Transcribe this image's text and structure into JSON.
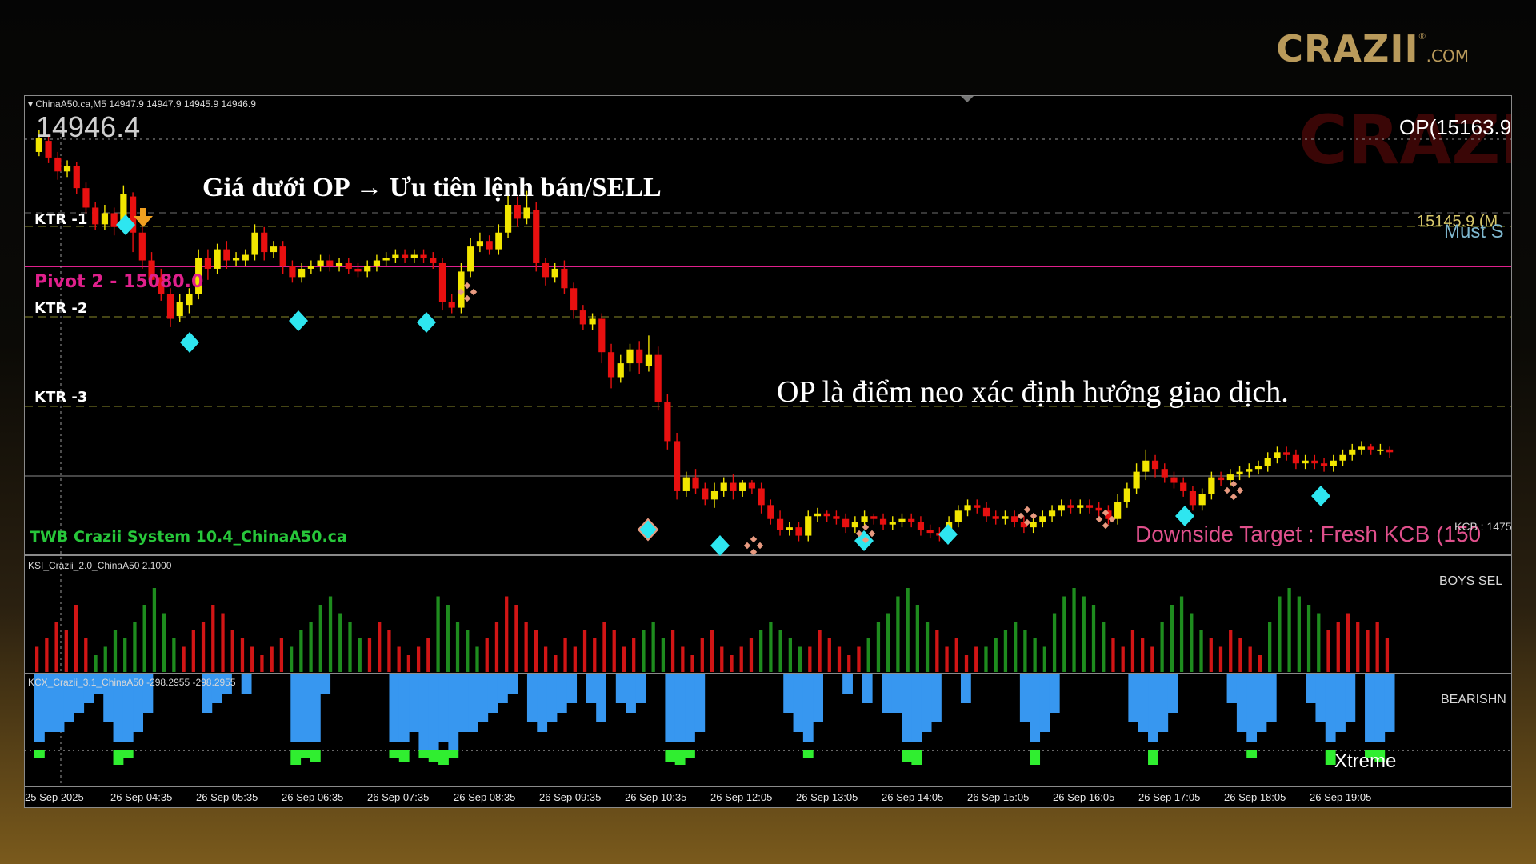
{
  "brand": {
    "name": "CRAZII",
    "reg": "®",
    "suffix": ".COM"
  },
  "chart": {
    "header": "ChinaA50.ca,M5  14947.9 14947.9 14945.9 14946.9",
    "current_price": "14946.4",
    "op_label": "OP(15163.9",
    "watermark": "CRAZII",
    "level_151": "15145.9 (M",
    "must_label": "Must S",
    "annotation_top": "Giá dưới OP → Ưu tiên lệnh bán/SELL",
    "annotation_mid": "OP là điểm neo xác định hướng giao dịch.",
    "ktr1": "KTR -1",
    "pivot2": "Pivot 2 - 15080.0",
    "ktr2": "KTR -2",
    "ktr3": "KTR -3",
    "system_label": "TWB Crazii System 10.4_ChinaA50.ca",
    "downside_target": "Downside Target : Fresh KCB (150",
    "kcb_label": "KCB : 1475"
  },
  "ksi": {
    "label": "KSI_Crazii_2.0_ChinaA50 2.1000",
    "side_label": "BOYS SEL"
  },
  "kcx": {
    "label": "KCX_Crazii_3.1_ChinaA50 -298.2955 -298.2955",
    "side_label": "BEARISHN",
    "xtreme": "Xtreme"
  },
  "time_axis": [
    "25 Sep 2025",
    "26 Sep 04:35",
    "26 Sep 05:35",
    "26 Sep 06:35",
    "26 Sep 07:35",
    "26 Sep 08:35",
    "26 Sep 09:35",
    "26 Sep 10:35",
    "26 Sep 12:05",
    "26 Sep 13:05",
    "26 Sep 14:05",
    "26 Sep 15:05",
    "26 Sep 16:05",
    "26 Sep 17:05",
    "26 Sep 18:05",
    "26 Sep 19:05"
  ],
  "colors": {
    "bull": "#f2e600",
    "bear": "#e81010",
    "pivot": "#e0208c",
    "diamond": "#2ee6f0",
    "system": "#27c73a",
    "target": "#e0508c",
    "hist_green": "#1e8c1e",
    "hist_red": "#d11515",
    "kcx_blue": "#3797f0",
    "kcx_green": "#30ee30"
  },
  "price_series": [
    {
      "o": 15142,
      "c": 15152,
      "h": 15158,
      "l": 15139
    },
    {
      "o": 15150,
      "c": 15138,
      "h": 15155,
      "l": 15134
    },
    {
      "o": 15138,
      "c": 15128,
      "h": 15142,
      "l": 15122
    },
    {
      "o": 15128,
      "c": 15132,
      "h": 15136,
      "l": 15124
    },
    {
      "o": 15132,
      "c": 15116,
      "h": 15135,
      "l": 15112
    },
    {
      "o": 15116,
      "c": 15102,
      "h": 15120,
      "l": 15098
    },
    {
      "o": 15102,
      "c": 15090,
      "h": 15106,
      "l": 15086
    },
    {
      "o": 15090,
      "c": 15098,
      "h": 15104,
      "l": 15086
    },
    {
      "o": 15098,
      "c": 15088,
      "h": 15102,
      "l": 15082
    },
    {
      "o": 15090,
      "c": 15112,
      "h": 15118,
      "l": 15087
    },
    {
      "o": 15110,
      "c": 15084,
      "h": 15113,
      "l": 15070
    },
    {
      "o": 15084,
      "c": 15064,
      "h": 15088,
      "l": 15058
    },
    {
      "o": 15064,
      "c": 15050,
      "h": 15070,
      "l": 15045
    },
    {
      "o": 15052,
      "c": 15040,
      "h": 15058,
      "l": 15035
    },
    {
      "o": 15040,
      "c": 15022,
      "h": 15044,
      "l": 15016
    },
    {
      "o": 15024,
      "c": 15034,
      "h": 15040,
      "l": 15020
    },
    {
      "o": 15032,
      "c": 15040,
      "h": 15044,
      "l": 15026
    },
    {
      "o": 15040,
      "c": 15066,
      "h": 15072,
      "l": 15036
    },
    {
      "o": 15066,
      "c": 15058,
      "h": 15072,
      "l": 15050
    },
    {
      "o": 15058,
      "c": 15072,
      "h": 15076,
      "l": 15054
    },
    {
      "o": 15072,
      "c": 15064,
      "h": 15078,
      "l": 15058
    },
    {
      "o": 15064,
      "c": 15066,
      "h": 15070,
      "l": 15060
    },
    {
      "o": 15064,
      "c": 15068,
      "h": 15072,
      "l": 15060
    },
    {
      "o": 15068,
      "c": 15084,
      "h": 15090,
      "l": 15064
    },
    {
      "o": 15084,
      "c": 15070,
      "h": 15088,
      "l": 15064
    },
    {
      "o": 15070,
      "c": 15074,
      "h": 15078,
      "l": 15066
    },
    {
      "o": 15074,
      "c": 15060,
      "h": 15078,
      "l": 15054
    },
    {
      "o": 15060,
      "c": 15052,
      "h": 15064,
      "l": 15048
    },
    {
      "o": 15052,
      "c": 15058,
      "h": 15062,
      "l": 15048
    },
    {
      "o": 15058,
      "c": 15060,
      "h": 15064,
      "l": 15054
    },
    {
      "o": 15060,
      "c": 15064,
      "h": 15068,
      "l": 15056
    },
    {
      "o": 15064,
      "c": 15060,
      "h": 15068,
      "l": 15056
    },
    {
      "o": 15060,
      "c": 15062,
      "h": 15066,
      "l": 15056
    },
    {
      "o": 15062,
      "c": 15058,
      "h": 15066,
      "l": 15054
    },
    {
      "o": 15058,
      "c": 15056,
      "h": 15062,
      "l": 15052
    },
    {
      "o": 15056,
      "c": 15060,
      "h": 15064,
      "l": 15052
    },
    {
      "o": 15060,
      "c": 15064,
      "h": 15068,
      "l": 15056
    },
    {
      "o": 15064,
      "c": 15066,
      "h": 15070,
      "l": 15060
    },
    {
      "o": 15066,
      "c": 15068,
      "h": 15072,
      "l": 15062
    },
    {
      "o": 15068,
      "c": 15066,
      "h": 15072,
      "l": 15062
    },
    {
      "o": 15066,
      "c": 15068,
      "h": 15072,
      "l": 15062
    },
    {
      "o": 15068,
      "c": 15066,
      "h": 15072,
      "l": 15062
    },
    {
      "o": 15066,
      "c": 15062,
      "h": 15070,
      "l": 15058
    },
    {
      "o": 15062,
      "c": 15034,
      "h": 15066,
      "l": 15028
    },
    {
      "o": 15034,
      "c": 15030,
      "h": 15040,
      "l": 15026
    },
    {
      "o": 15030,
      "c": 15056,
      "h": 15062,
      "l": 15026
    },
    {
      "o": 15056,
      "c": 15074,
      "h": 15080,
      "l": 15052
    },
    {
      "o": 15074,
      "c": 15078,
      "h": 15084,
      "l": 15070
    },
    {
      "o": 15078,
      "c": 15072,
      "h": 15082,
      "l": 15068
    },
    {
      "o": 15072,
      "c": 15084,
      "h": 15090,
      "l": 15068
    },
    {
      "o": 15084,
      "c": 15104,
      "h": 15112,
      "l": 15080
    },
    {
      "o": 15104,
      "c": 15094,
      "h": 15110,
      "l": 15088
    },
    {
      "o": 15094,
      "c": 15102,
      "h": 15114,
      "l": 15090
    },
    {
      "o": 15100,
      "c": 15062,
      "h": 15106,
      "l": 15056
    },
    {
      "o": 15062,
      "c": 15052,
      "h": 15066,
      "l": 15046
    },
    {
      "o": 15052,
      "c": 15058,
      "h": 15062,
      "l": 15048
    },
    {
      "o": 15058,
      "c": 15044,
      "h": 15064,
      "l": 15040
    },
    {
      "o": 15044,
      "c": 15028,
      "h": 15048,
      "l": 15022
    },
    {
      "o": 15028,
      "c": 15018,
      "h": 15032,
      "l": 15014
    },
    {
      "o": 15018,
      "c": 15022,
      "h": 15026,
      "l": 15014
    },
    {
      "o": 15022,
      "c": 14998,
      "h": 15026,
      "l": 14990
    },
    {
      "o": 14998,
      "c": 14980,
      "h": 15004,
      "l": 14972
    },
    {
      "o": 14980,
      "c": 14990,
      "h": 14996,
      "l": 14976
    },
    {
      "o": 14990,
      "c": 15000,
      "h": 15004,
      "l": 14984
    },
    {
      "o": 15000,
      "c": 14990,
      "h": 15006,
      "l": 14982
    },
    {
      "o": 14988,
      "c": 14996,
      "h": 15010,
      "l": 14984
    },
    {
      "o": 14996,
      "c": 14962,
      "h": 15002,
      "l": 14956
    },
    {
      "o": 14962,
      "c": 14934,
      "h": 14968,
      "l": 14928
    },
    {
      "o": 14934,
      "c": 14898,
      "h": 14940,
      "l": 14892
    },
    {
      "o": 14898,
      "c": 14908,
      "h": 14912,
      "l": 14894
    },
    {
      "o": 14908,
      "c": 14900,
      "h": 14914,
      "l": 14896
    },
    {
      "o": 14900,
      "c": 14892,
      "h": 14904,
      "l": 14888
    },
    {
      "o": 14892,
      "c": 14898,
      "h": 14904,
      "l": 14886
    },
    {
      "o": 14898,
      "c": 14904,
      "h": 14908,
      "l": 14894
    },
    {
      "o": 14904,
      "c": 14898,
      "h": 14910,
      "l": 14892
    },
    {
      "o": 14898,
      "c": 14904,
      "h": 14906,
      "l": 14894
    },
    {
      "o": 14904,
      "c": 14900,
      "h": 14906,
      "l": 14896
    },
    {
      "o": 14900,
      "c": 14888,
      "h": 14904,
      "l": 14882
    },
    {
      "o": 14888,
      "c": 14878,
      "h": 14892,
      "l": 14874
    },
    {
      "o": 14878,
      "c": 14870,
      "h": 14884,
      "l": 14866
    },
    {
      "o": 14870,
      "c": 14872,
      "h": 14876,
      "l": 14866
    },
    {
      "o": 14872,
      "c": 14866,
      "h": 14876,
      "l": 14862
    },
    {
      "o": 14866,
      "c": 14880,
      "h": 14884,
      "l": 14862
    },
    {
      "o": 14880,
      "c": 14882,
      "h": 14886,
      "l": 14876
    },
    {
      "o": 14882,
      "c": 14880,
      "h": 14884,
      "l": 14876
    },
    {
      "o": 14880,
      "c": 14878,
      "h": 14884,
      "l": 14874
    },
    {
      "o": 14878,
      "c": 14872,
      "h": 14882,
      "l": 14868
    },
    {
      "o": 14872,
      "c": 14876,
      "h": 14880,
      "l": 14868
    },
    {
      "o": 14876,
      "c": 14880,
      "h": 14884,
      "l": 14872
    },
    {
      "o": 14880,
      "c": 14878,
      "h": 14882,
      "l": 14874
    },
    {
      "o": 14878,
      "c": 14874,
      "h": 14882,
      "l": 14870
    },
    {
      "o": 14874,
      "c": 14876,
      "h": 14880,
      "l": 14870
    },
    {
      "o": 14876,
      "c": 14878,
      "h": 14882,
      "l": 14872
    },
    {
      "o": 14878,
      "c": 14876,
      "h": 14882,
      "l": 14872
    },
    {
      "o": 14876,
      "c": 14870,
      "h": 14880,
      "l": 14866
    },
    {
      "o": 14870,
      "c": 14868,
      "h": 14874,
      "l": 14864
    },
    {
      "o": 14868,
      "c": 14866,
      "h": 14872,
      "l": 14862
    },
    {
      "o": 14866,
      "c": 14876,
      "h": 14880,
      "l": 14862
    },
    {
      "o": 14876,
      "c": 14884,
      "h": 14888,
      "l": 14872
    },
    {
      "o": 14884,
      "c": 14888,
      "h": 14892,
      "l": 14880
    },
    {
      "o": 14888,
      "c": 14886,
      "h": 14892,
      "l": 14882
    },
    {
      "o": 14886,
      "c": 14880,
      "h": 14890,
      "l": 14876
    },
    {
      "o": 14880,
      "c": 14878,
      "h": 14884,
      "l": 14874
    },
    {
      "o": 14878,
      "c": 14880,
      "h": 14884,
      "l": 14874
    },
    {
      "o": 14880,
      "c": 14876,
      "h": 14884,
      "l": 14872
    },
    {
      "o": 14876,
      "c": 14872,
      "h": 14880,
      "l": 14868
    },
    {
      "o": 14872,
      "c": 14876,
      "h": 14880,
      "l": 14868
    },
    {
      "o": 14876,
      "c": 14880,
      "h": 14884,
      "l": 14872
    },
    {
      "o": 14880,
      "c": 14884,
      "h": 14888,
      "l": 14876
    },
    {
      "o": 14884,
      "c": 14888,
      "h": 14892,
      "l": 14880
    },
    {
      "o": 14888,
      "c": 14886,
      "h": 14892,
      "l": 14882
    },
    {
      "o": 14886,
      "c": 14888,
      "h": 14892,
      "l": 14882
    },
    {
      "o": 14888,
      "c": 14886,
      "h": 14892,
      "l": 14882
    },
    {
      "o": 14886,
      "c": 14884,
      "h": 14890,
      "l": 14880
    },
    {
      "o": 14884,
      "c": 14878,
      "h": 14888,
      "l": 14874
    },
    {
      "o": 14878,
      "c": 14890,
      "h": 14896,
      "l": 14874
    },
    {
      "o": 14890,
      "c": 14900,
      "h": 14904,
      "l": 14886
    },
    {
      "o": 14900,
      "c": 14912,
      "h": 14918,
      "l": 14896
    },
    {
      "o": 14912,
      "c": 14920,
      "h": 14928,
      "l": 14906
    },
    {
      "o": 14920,
      "c": 14914,
      "h": 14924,
      "l": 14908
    },
    {
      "o": 14914,
      "c": 14908,
      "h": 14918,
      "l": 14904
    },
    {
      "o": 14908,
      "c": 14904,
      "h": 14912,
      "l": 14900
    },
    {
      "o": 14904,
      "c": 14898,
      "h": 14908,
      "l": 14894
    },
    {
      "o": 14898,
      "c": 14888,
      "h": 14902,
      "l": 14884
    },
    {
      "o": 14888,
      "c": 14896,
      "h": 14900,
      "l": 14884
    },
    {
      "o": 14896,
      "c": 14908,
      "h": 14912,
      "l": 14892
    },
    {
      "o": 14908,
      "c": 14906,
      "h": 14912,
      "l": 14902
    },
    {
      "o": 14906,
      "c": 14910,
      "h": 14914,
      "l": 14902
    },
    {
      "o": 14910,
      "c": 14912,
      "h": 14916,
      "l": 14906
    },
    {
      "o": 14912,
      "c": 14914,
      "h": 14918,
      "l": 14908
    },
    {
      "o": 14914,
      "c": 14916,
      "h": 14920,
      "l": 14910
    },
    {
      "o": 14916,
      "c": 14922,
      "h": 14926,
      "l": 14912
    },
    {
      "o": 14922,
      "c": 14926,
      "h": 14930,
      "l": 14918
    },
    {
      "o": 14926,
      "c": 14924,
      "h": 14930,
      "l": 14920
    },
    {
      "o": 14924,
      "c": 14918,
      "h": 14928,
      "l": 14914
    },
    {
      "o": 14918,
      "c": 14920,
      "h": 14924,
      "l": 14914
    },
    {
      "o": 14920,
      "c": 14918,
      "h": 14924,
      "l": 14914
    },
    {
      "o": 14918,
      "c": 14916,
      "h": 14922,
      "l": 14912
    },
    {
      "o": 14916,
      "c": 14920,
      "h": 14924,
      "l": 14912
    },
    {
      "o": 14920,
      "c": 14924,
      "h": 14928,
      "l": 14916
    },
    {
      "o": 14924,
      "c": 14928,
      "h": 14932,
      "l": 14920
    },
    {
      "o": 14928,
      "c": 14930,
      "h": 14934,
      "l": 14924
    },
    {
      "o": 14930,
      "c": 14928,
      "h": 14932,
      "l": 14924
    },
    {
      "o": 14928,
      "c": 14928,
      "h": 14932,
      "l": 14924
    },
    {
      "o": 14928,
      "c": 14926,
      "h": 14930,
      "l": 14922
    }
  ],
  "ksi_values": [
    -0.3,
    -0.4,
    -0.6,
    -0.5,
    -0.8,
    -0.4,
    0.2,
    0.3,
    0.5,
    0.4,
    0.6,
    0.8,
    1.0,
    0.7,
    0.4,
    -0.3,
    -0.5,
    -0.6,
    -0.8,
    -0.7,
    -0.5,
    -0.4,
    -0.3,
    -0.2,
    -0.3,
    -0.4,
    0.3,
    0.5,
    0.6,
    0.8,
    0.9,
    0.7,
    0.6,
    0.4,
    -0.4,
    -0.6,
    -0.5,
    -0.3,
    -0.2,
    -0.3,
    -0.4,
    0.9,
    0.8,
    0.6,
    0.5,
    0.3,
    -0.4,
    -0.6,
    -0.9,
    -0.8,
    -0.6,
    -0.5,
    -0.3,
    -0.2,
    -0.4,
    -0.3,
    -0.5,
    -0.4,
    -0.6,
    -0.5,
    -0.3,
    -0.4,
    0.5,
    0.6,
    0.4,
    -0.5,
    -0.3,
    -0.2,
    -0.4,
    -0.5,
    -0.3,
    -0.2,
    -0.3,
    -0.4,
    0.5,
    0.6,
    0.5,
    0.4,
    0.3,
    -0.3,
    -0.5,
    -0.4,
    -0.3,
    -0.2,
    -0.3,
    0.4,
    0.6,
    0.7,
    0.9,
    1.0,
    0.8,
    0.6,
    -0.5,
    -0.3,
    -0.4,
    -0.2,
    -0.3,
    0.3,
    0.4,
    0.5,
    0.6,
    0.5,
    0.4,
    0.3,
    0.7,
    0.9,
    1.0,
    0.9,
    0.8,
    0.6,
    -0.4,
    -0.3,
    -0.5,
    -0.4,
    -0.3,
    0.6,
    0.8,
    0.9,
    0.7,
    0.5,
    -0.4,
    -0.3,
    -0.5,
    -0.4,
    -0.3,
    -0.2,
    0.6,
    0.9,
    1.0,
    0.9,
    0.8,
    0.7,
    -0.5,
    -0.6,
    -0.7,
    -0.6,
    -0.5,
    -0.6,
    -0.4
  ],
  "kcx_values": [
    -0.7,
    -0.6,
    -0.6,
    -0.5,
    -0.4,
    -0.3,
    -0.2,
    -0.5,
    -0.7,
    -0.7,
    -0.6,
    -0.4,
    0,
    0,
    0,
    0,
    0,
    -0.4,
    -0.3,
    -0.2,
    0,
    -0.2,
    0,
    0,
    0,
    0,
    -0.7,
    -0.7,
    -0.7,
    -0.2,
    0,
    0,
    0,
    0,
    0,
    0,
    -0.7,
    -0.7,
    -0.6,
    -0.8,
    -0.8,
    -0.7,
    -0.8,
    -0.6,
    -0.6,
    -0.5,
    -0.4,
    -0.3,
    -0.2,
    0,
    -0.5,
    -0.6,
    -0.5,
    -0.4,
    -0.3,
    0,
    -0.3,
    -0.5,
    0,
    -0.3,
    -0.4,
    -0.3,
    0,
    0,
    -0.7,
    -0.7,
    -0.7,
    -0.6,
    0,
    0,
    0,
    0,
    0,
    0,
    0,
    0,
    -0.4,
    -0.6,
    -0.7,
    -0.5,
    0,
    0,
    -0.2,
    0,
    -0.3,
    0,
    -0.4,
    -0.4,
    -0.7,
    -0.7,
    -0.6,
    -0.5,
    0,
    0,
    -0.3,
    0,
    0,
    0,
    0,
    0,
    -0.5,
    -0.7,
    -0.6,
    -0.4,
    0,
    0,
    0,
    0,
    0,
    0,
    0,
    -0.5,
    -0.6,
    -0.7,
    -0.6,
    -0.4,
    0,
    0,
    0,
    0,
    0,
    -0.3,
    -0.6,
    -0.7,
    -0.6,
    -0.5,
    0,
    0,
    0,
    -0.3,
    -0.5,
    -0.7,
    -0.6,
    -0.5,
    0,
    -0.7,
    -0.7,
    -0.6
  ]
}
